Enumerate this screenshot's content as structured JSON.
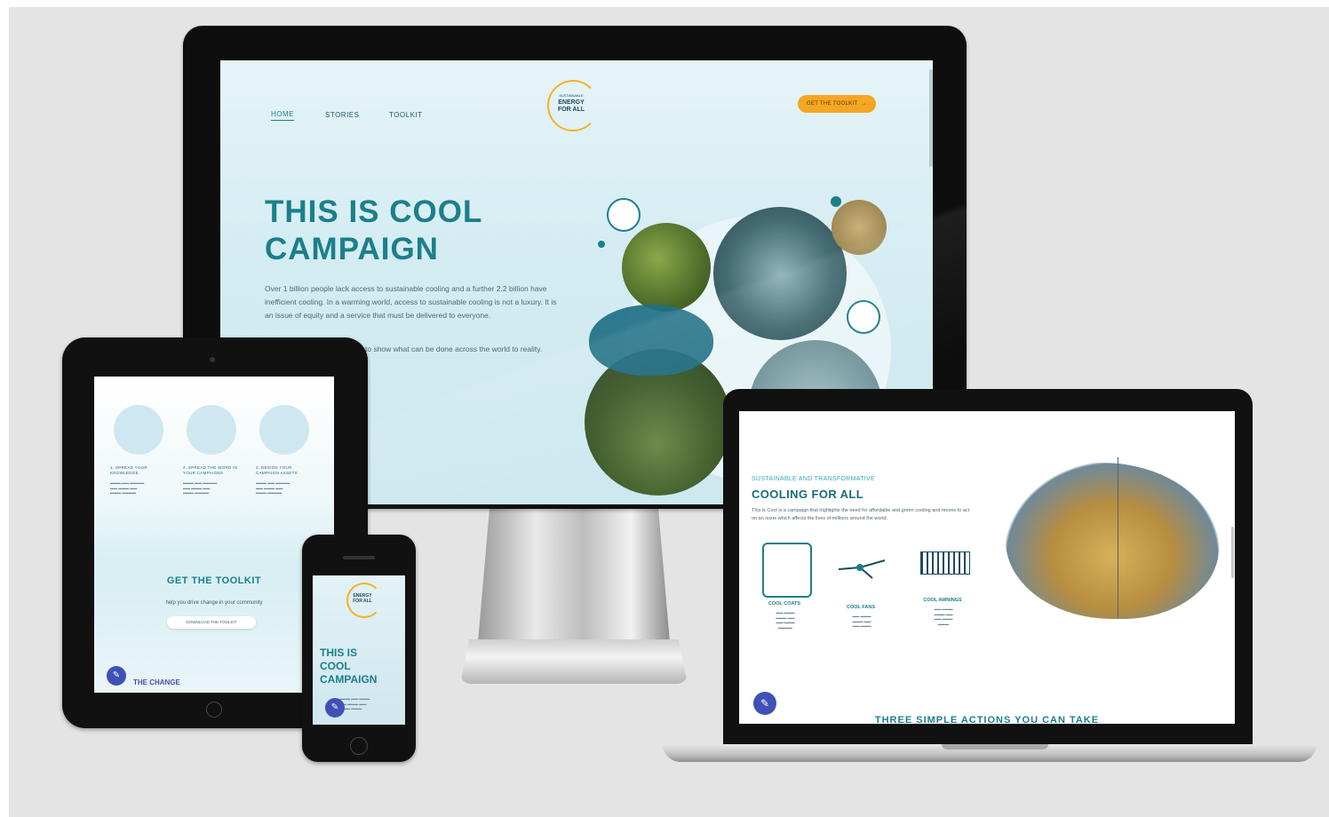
{
  "colors": {
    "teal": "#1b7f8a",
    "orange": "#f5a623",
    "edit_fab": "#3f51b5"
  },
  "desktop": {
    "nav": {
      "home": "HOME",
      "stories": "STORIES",
      "toolkit": "TOOLKIT"
    },
    "logo": {
      "line1": "SUSTAINABLE",
      "line2": "ENERGY",
      "line3": "FOR ALL"
    },
    "cta": "GET THE TOOLKIT",
    "hero": {
      "title_line1": "THIS IS COOL",
      "title_line2": "CAMPAIGN",
      "para1": "Over 1 billion people lack access to sustainable cooling and a further 2.2 billion have inefficient cooling. In a warming world, access to sustainable cooling is not a luxury. It is an issue of equity and a service that must be delivered to everyone.",
      "para2": "to show what can be done across the world to reality."
    }
  },
  "tablet": {
    "cards": [
      {
        "title": "1. SPREAD YOUR KNOWLEDGE",
        "icon": "fan-icon"
      },
      {
        "title": "2. SPREAD THE WORD IN YOUR CAMPAIGNS",
        "icon": "phone-icon"
      },
      {
        "title": "3. DESIGN YOUR CAMPAIGN ASSETS",
        "icon": "map-icon"
      }
    ],
    "toolkit_heading": "GET THE TOOLKIT",
    "toolkit_text": "help you drive change in your community",
    "toolkit_button": "DOWNLOAD THE TOOLKIT",
    "change_heading": "THE CHANGE"
  },
  "phone": {
    "title_line1": "THIS IS",
    "title_line2": "COOL",
    "title_line3": "CAMPAIGN",
    "logo_text": "ENERGY FOR ALL"
  },
  "laptop": {
    "eyebrow": "SUSTAINABLE AND TRANSFORMATIVE",
    "heading": "COOLING FOR ALL",
    "intro": "This is Cool is a campaign that highlights the need for affordable and green cooling and moves to act on an issue which affects the lives of millions around the world.",
    "features": [
      {
        "label": "COOL COATS",
        "icon": "coat-icon"
      },
      {
        "label": "COOL FANS",
        "icon": "fan-icon"
      },
      {
        "label": "COOL AWNINGS",
        "icon": "awning-icon"
      }
    ],
    "section_heading": "THREE SIMPLE ACTIONS YOU CAN TAKE"
  }
}
